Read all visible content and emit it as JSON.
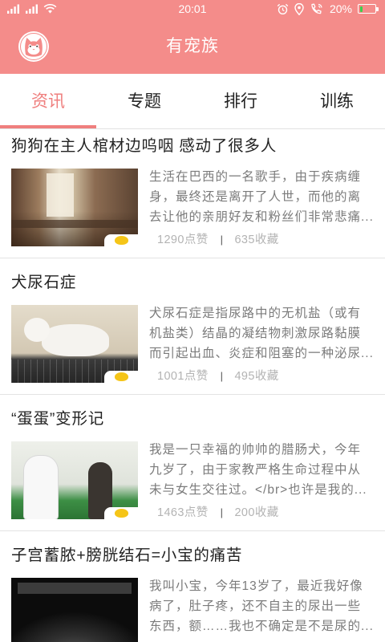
{
  "status_bar": {
    "time": "20:01",
    "battery_text": "20%",
    "battery_level": 0.2,
    "left_icons": [
      "cellular-signal-icon",
      "cellular-signal-icon",
      "wifi-icon"
    ],
    "right_icons": [
      "alarm-icon",
      "location-icon",
      "call-icon",
      "battery-icon"
    ]
  },
  "header": {
    "title": "有宠族",
    "logo_icon": "cat-logo-icon"
  },
  "tabs": [
    {
      "label": "资讯",
      "active": true
    },
    {
      "label": "专题",
      "active": false
    },
    {
      "label": "排行",
      "active": false
    },
    {
      "label": "训练",
      "active": false
    }
  ],
  "stats_separator": "|",
  "articles": [
    {
      "title": "狗狗在主人棺材边呜咽 感动了很多人",
      "desc_lines": [
        "生活在巴西的一名歌手，由于疾病缠",
        "身，最终还是离开了人世，而他的离",
        "去让他的亲朋好友和粉丝们非常悲痛..."
      ],
      "likes": "1290点赞",
      "favorites": "635收藏"
    },
    {
      "title": "犬尿石症",
      "desc_lines": [
        "犬尿石症是指尿路中的无机盐（或有",
        "机盐类）结晶的凝结物刺激尿路黏膜",
        "而引起出血、炎症和阻塞的一种泌尿..."
      ],
      "likes": "1001点赞",
      "favorites": "495收藏"
    },
    {
      "title": "“蛋蛋”变形记",
      "desc_lines": [
        "我是一只幸福的帅帅的腊肠犬，今年",
        "九岁了，由于家教严格生命过程中从",
        "未与女生交往过。</br>也许是我的..."
      ],
      "likes": "1463点赞",
      "favorites": "200收藏"
    },
    {
      "title": "子宫蓄脓+膀胱结石=小宝的痛苦",
      "desc_lines": [
        "我叫小宝，今年13岁了，最近我好像",
        "病了，肚子疼，还不自主的尿出一些",
        "东西，额……我也不确定是不是尿的..."
      ]
    }
  ],
  "colors": {
    "accent": "#f48c8a",
    "active_tab": "#ef7f7e",
    "title_text": "#222222",
    "summary_text": "#7b7b7b",
    "stats_text": "#b3b3b3",
    "separator_text": "#555555",
    "battery_fill": "#3ccf4e"
  }
}
